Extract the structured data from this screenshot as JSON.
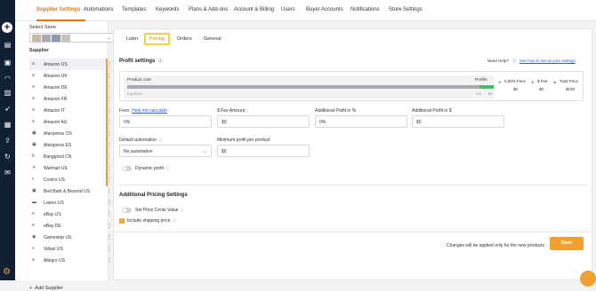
{
  "top_tabs": [
    {
      "label": "Supplier Settings",
      "active": true
    },
    {
      "label": "Automations"
    },
    {
      "label": "Templates"
    },
    {
      "label": "Keywords"
    },
    {
      "label": "Plans & Add-ons"
    },
    {
      "label": "Account & Billing"
    },
    {
      "label": "Users"
    },
    {
      "label": "Buyer Accounts"
    },
    {
      "label": "Notifications"
    },
    {
      "label": "Store Settings"
    }
  ],
  "sidebar": {
    "select_store_label": "Select Store",
    "supplier_label": "Supplier",
    "add_supplier_label": "Add Supplier",
    "suppliers": [
      {
        "name": "Amazon US",
        "icon": "amazon-icon",
        "selected": true
      },
      {
        "name": "Amazon UK",
        "icon": "amazon-icon"
      },
      {
        "name": "Amazon DE",
        "icon": "amazon-icon"
      },
      {
        "name": "Amazon FR",
        "icon": "amazon-icon"
      },
      {
        "name": "Amazon IT",
        "icon": "amazon-icon"
      },
      {
        "name": "Amazon AU",
        "icon": "amazon-icon"
      },
      {
        "name": "Aliexpress CN",
        "icon": "aliexpress-icon"
      },
      {
        "name": "Aliexpress ES",
        "icon": "aliexpress-icon"
      },
      {
        "name": "Banggood CN",
        "icon": "banggood-icon"
      },
      {
        "name": "Walmart US",
        "icon": "walmart-icon"
      },
      {
        "name": "Costco US",
        "icon": "costco-icon"
      },
      {
        "name": "Bed Bath & Beyond US",
        "icon": "bedbath-icon"
      },
      {
        "name": "Lowes US",
        "icon": "lowes-icon"
      },
      {
        "name": "eBay US",
        "icon": "ebay-icon"
      },
      {
        "name": "eBay DE",
        "icon": "ebay-icon"
      },
      {
        "name": "Gamestop US",
        "icon": "gamestop-icon"
      },
      {
        "name": "Vidaxl US",
        "icon": "vidaxl-icon"
      },
      {
        "name": "Allegro US",
        "icon": "allegro-icon"
      }
    ]
  },
  "sub_tabs": [
    {
      "label": "Lister"
    },
    {
      "label": "Pricing",
      "active": true
    },
    {
      "label": "Orders"
    },
    {
      "label": "General"
    }
  ],
  "profit": {
    "title": "Profit settings",
    "need_help": "Need Help?",
    "help_link": "See how to set up your settings",
    "product_cost_label": "Product cost",
    "product_cost_hint": "e.g: $100",
    "profits_label": "Profits",
    "profit_pct": "0%",
    "profit_amt": "$0",
    "fees_pct": "0.00% Fees",
    "fees_amt": "$0",
    "fee_label": "$ Fee",
    "fee_amt": "$0",
    "total_label": "Total Price",
    "total_amt": "$100"
  },
  "fields": {
    "fees_label": "Fees",
    "fees_link": "Help me calculate",
    "fees_value": "0%",
    "fee_amount_label": "$ Fee Amount",
    "fee_amount_value": "$0",
    "add_profit_pct_label": "Additional Profit in %",
    "add_profit_pct_value": "0%",
    "add_profit_usd_label": "Additional Profit in $",
    "add_profit_usd_value": "$0",
    "default_automation_label": "Default automation",
    "default_automation_value": "No automation",
    "min_profit_label": "Minimum profit per product",
    "min_profit_value": "$0",
    "dynamic_profit_label": "Dynamic profit"
  },
  "additional": {
    "title": "Additional Pricing Settings",
    "set_cents_label": "Set Price Cents Value",
    "include_shipping_label": "Include shipping price"
  },
  "footer": {
    "note": "Changes will be applied only for the new products",
    "save_label": "Save"
  }
}
